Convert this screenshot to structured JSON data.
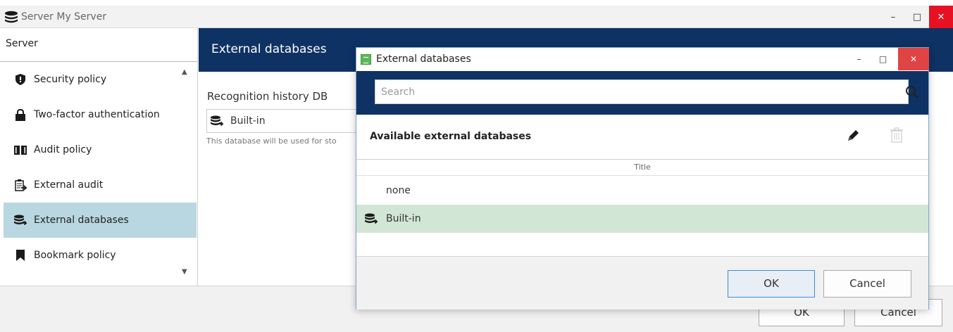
{
  "window": {
    "title": "Server My Server",
    "minimize_glyph": "–",
    "maximize_glyph": "□",
    "close_glyph": "✕",
    "close_color": "#e81123"
  },
  "sidebar": {
    "header": "Server",
    "items": [
      {
        "label": "Security policy",
        "icon": "shield-icon"
      },
      {
        "label": "Two-factor authentication",
        "icon": "lock-icon"
      },
      {
        "label": "Audit policy",
        "icon": "book-icon"
      },
      {
        "label": "External audit",
        "icon": "external-audit-icon"
      },
      {
        "label": "External databases",
        "icon": "database-icon",
        "selected": true
      },
      {
        "label": "Bookmark policy",
        "icon": "bookmark-icon"
      }
    ],
    "selected_color": "#b9d7e0"
  },
  "content": {
    "title": "External databases",
    "header_color": "#0e3263",
    "recognition_label": "Recognition history DB",
    "recognition_value": "Built-in",
    "note": "This database will be used for sto"
  },
  "footer": {
    "ok_label": "OK",
    "cancel_label": "Cancel"
  },
  "dialog": {
    "title": "External databases",
    "search_placeholder": "Search",
    "available_label": "Available external databases",
    "column_title": "Title",
    "rows": [
      {
        "label": "none",
        "icon": null
      },
      {
        "label": "Built-in",
        "icon": "database-icon",
        "selected": true
      }
    ],
    "ok_label": "OK",
    "cancel_label": "Cancel",
    "selected_row_color": "#d1e6d5",
    "close_color": "#e04343"
  }
}
